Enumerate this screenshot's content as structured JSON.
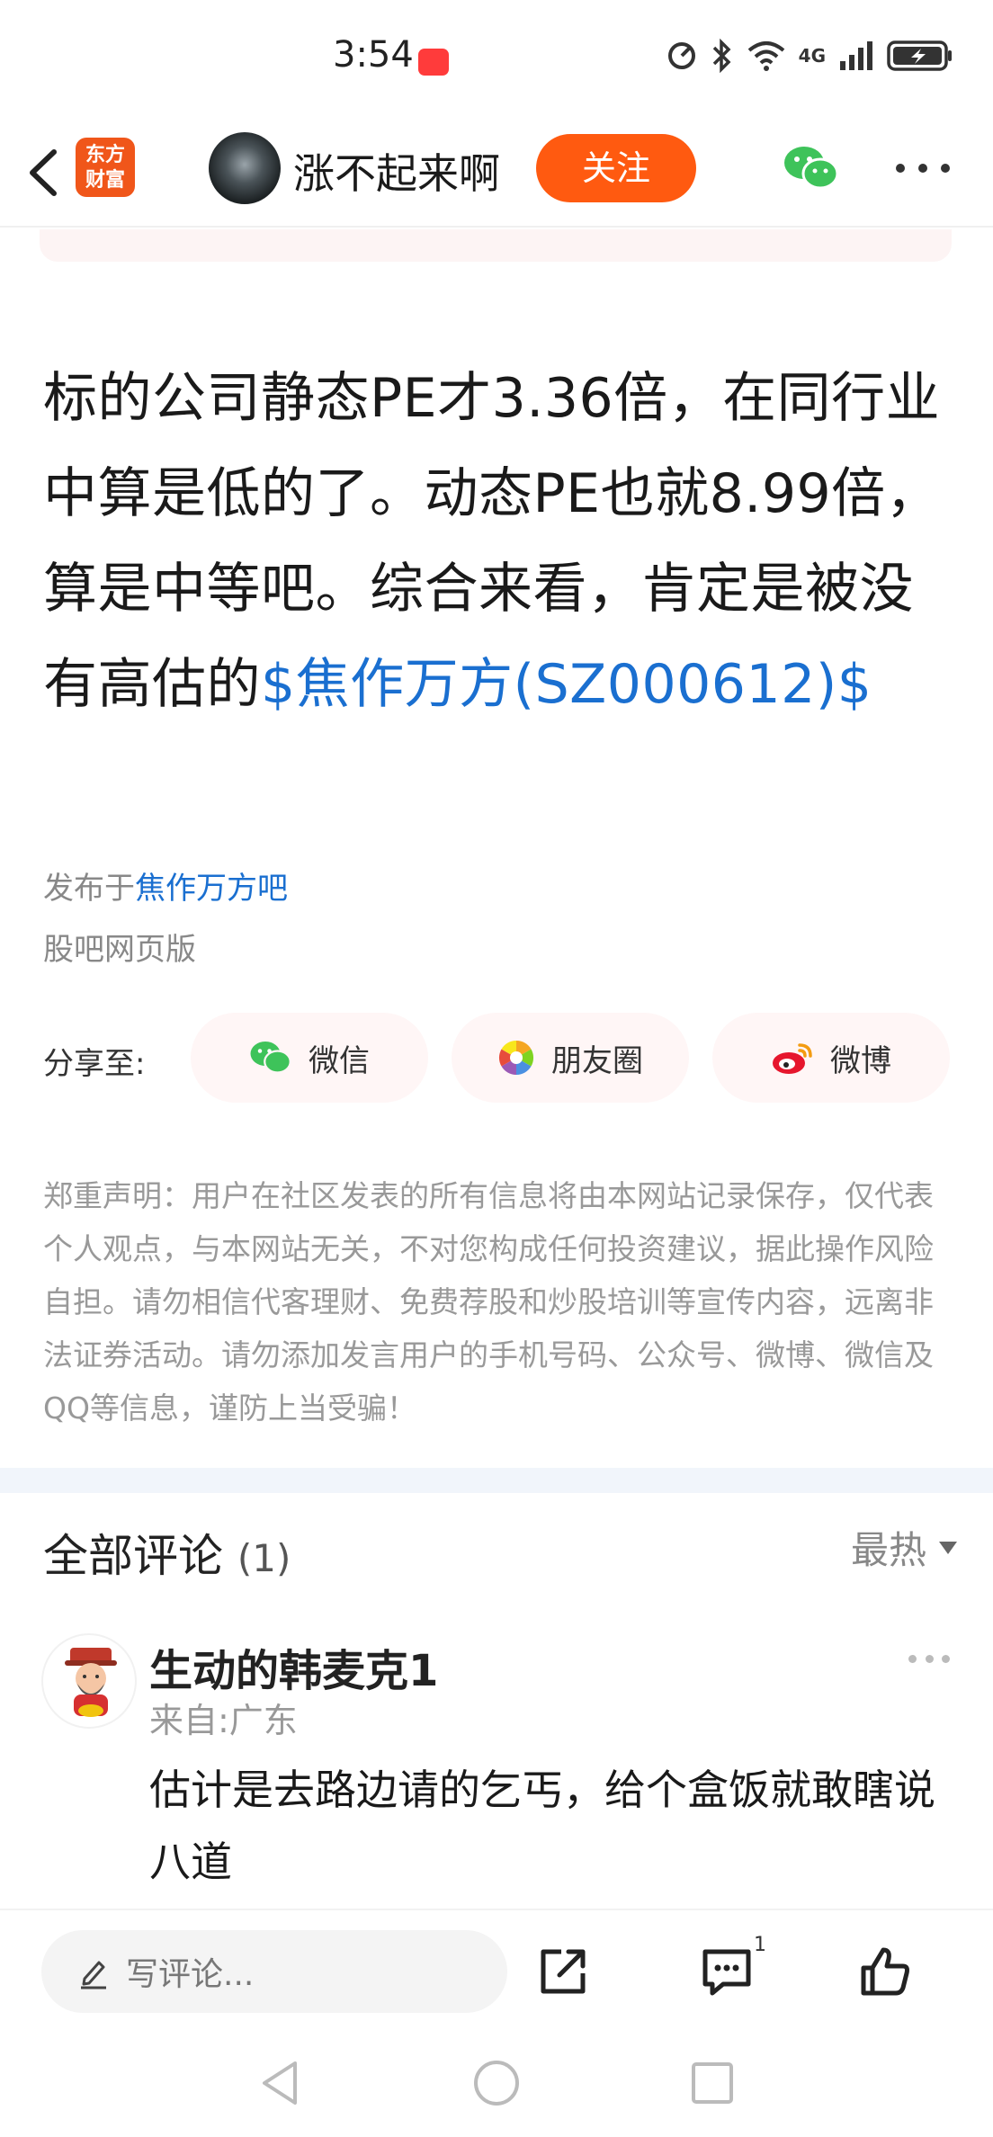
{
  "status_bar": {
    "time": "3:54",
    "network": "4G",
    "icons": [
      "hd-icon",
      "bluetooth-icon",
      "wifi-icon",
      "signal-icon",
      "battery-charging-icon"
    ]
  },
  "header": {
    "logo_line1": "东方",
    "logo_line2": "财富",
    "author_name": "涨不起来啊",
    "follow_label": "关注"
  },
  "article": {
    "text": "标的公司静态PE才3.36倍，在同行业中算是低的了。动态PE也就8.99倍，算是中等吧。综合来看，肯定是被没有高估的",
    "stock_link": "$焦作万方(SZ000612)$",
    "published_prefix": "发布于",
    "bar_name": "焦作万方吧",
    "source": "股吧网页版"
  },
  "share": {
    "label": "分享至:",
    "wechat": "微信",
    "moments": "朋友圈",
    "weibo": "微博"
  },
  "disclaimer": "郑重声明：用户在社区发表的所有信息将由本网站记录保存，仅代表个人观点，与本网站无关，不对您构成任何投资建议，据此操作风险自担。请勿相信代客理财、免费荐股和炒股培训等宣传内容，远离非法证券活动。请勿添加发言用户的手机号码、公众号、微博、微信及QQ等信息，谨防上当受骗！",
  "comments": {
    "title": "全部评论",
    "count": "(1)",
    "sort_label": "最热",
    "items": [
      {
        "user": "生动的韩麦克1",
        "location": "来自:广东",
        "text": "估计是去路边请的乞丐，给个盒饭就敢瞎说八道"
      }
    ]
  },
  "bottom_bar": {
    "comment_placeholder": "写评论...",
    "comment_count": "1"
  },
  "colors": {
    "accent": "#ff5a10",
    "link": "#1a6fd0",
    "muted": "#999999"
  }
}
